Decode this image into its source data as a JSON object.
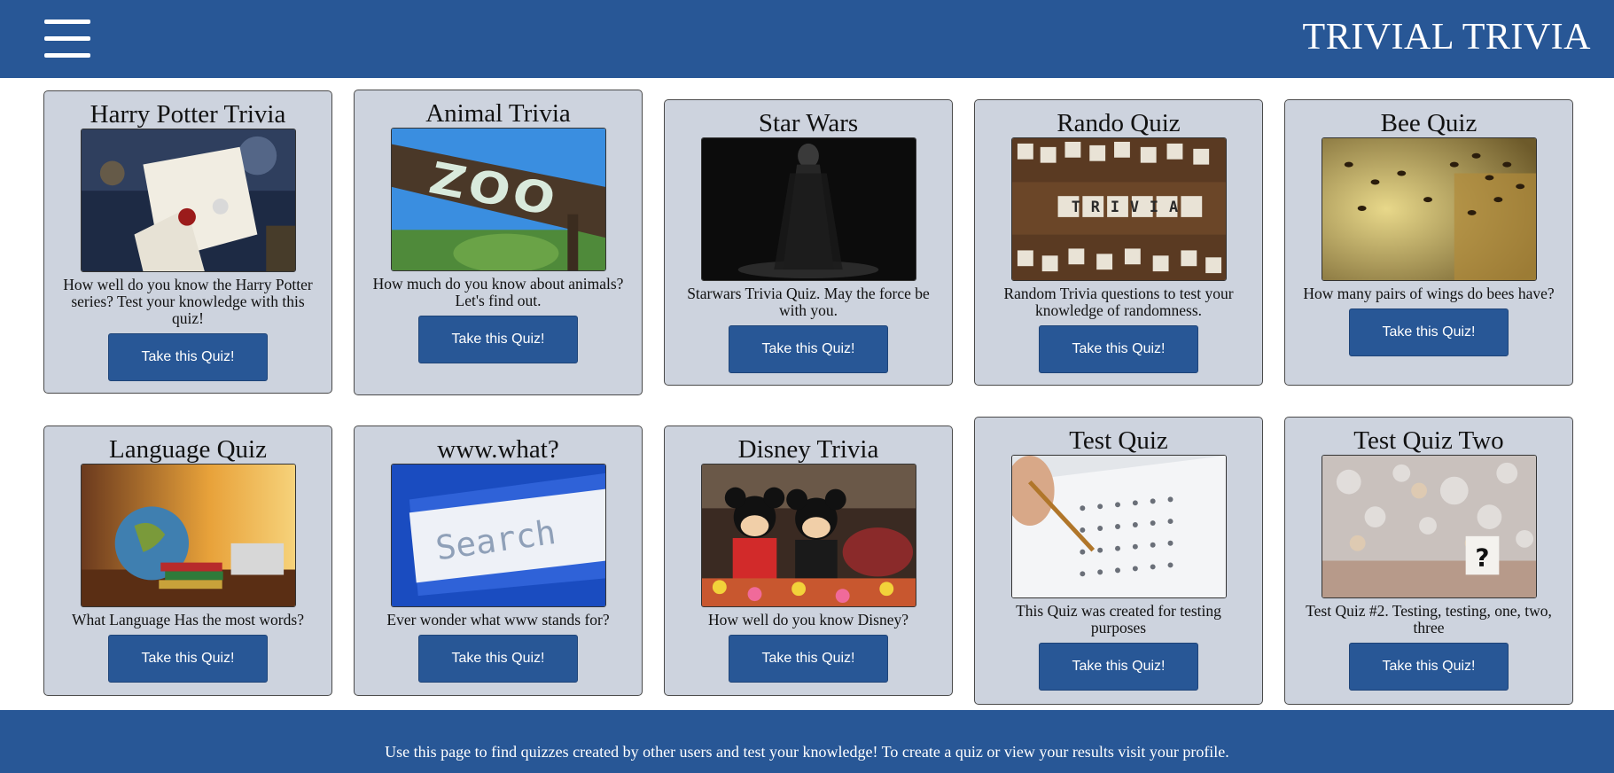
{
  "header": {
    "title": "TRIVIAL TRIVIA",
    "menu_icon": "hamburger-menu-icon",
    "background": "#285796"
  },
  "quizzes": [
    {
      "title": "Harry Potter Trivia",
      "description": "How well do you know the Harry Potter series? Test your knowledge with this quiz!",
      "button": "Take this Quiz!",
      "image": "harry-potter-letter"
    },
    {
      "title": "Animal Trivia",
      "description": "How much do you know about animals? Let's find out.",
      "button": "Take this Quiz!",
      "image": "zoo-sign"
    },
    {
      "title": "Star Wars",
      "description": "Starwars Trivia Quiz. May the force be with you.",
      "button": "Take this Quiz!",
      "image": "darth-vader"
    },
    {
      "title": "Rando Quiz",
      "description": "Random Trivia questions to test your knowledge of randomness.",
      "button": "Take this Quiz!",
      "image": "trivia-letter-cubes",
      "image_text": "TRIVIA"
    },
    {
      "title": "Bee Quiz",
      "description": "How many pairs of wings do bees have?",
      "button": "Take this Quiz!",
      "image": "bees"
    },
    {
      "title": "Language Quiz",
      "description": "What Language Has the most words?",
      "button": "Take this Quiz!",
      "image": "globe-and-books"
    },
    {
      "title": "www.what?",
      "description": "Ever wonder what www stands for?",
      "button": "Take this Quiz!",
      "image": "search-bar",
      "image_text": "Search"
    },
    {
      "title": "Disney Trivia",
      "description": "How well do you know Disney?",
      "button": "Take this Quiz!",
      "image": "mickey-and-minnie"
    },
    {
      "title": "Test Quiz",
      "description": "This Quiz was created for testing purposes",
      "button": "Take this Quiz!",
      "image": "answer-sheet"
    },
    {
      "title": "Test Quiz Two",
      "description": "Test Quiz #2. Testing, testing, one, two, three",
      "button": "Take this Quiz!",
      "image": "question-mark-bokeh",
      "image_text": "?"
    }
  ],
  "footer": {
    "text": "Use this page to find quizzes created by other users and test your knowledge! To create a quiz or view your results visit your profile."
  }
}
